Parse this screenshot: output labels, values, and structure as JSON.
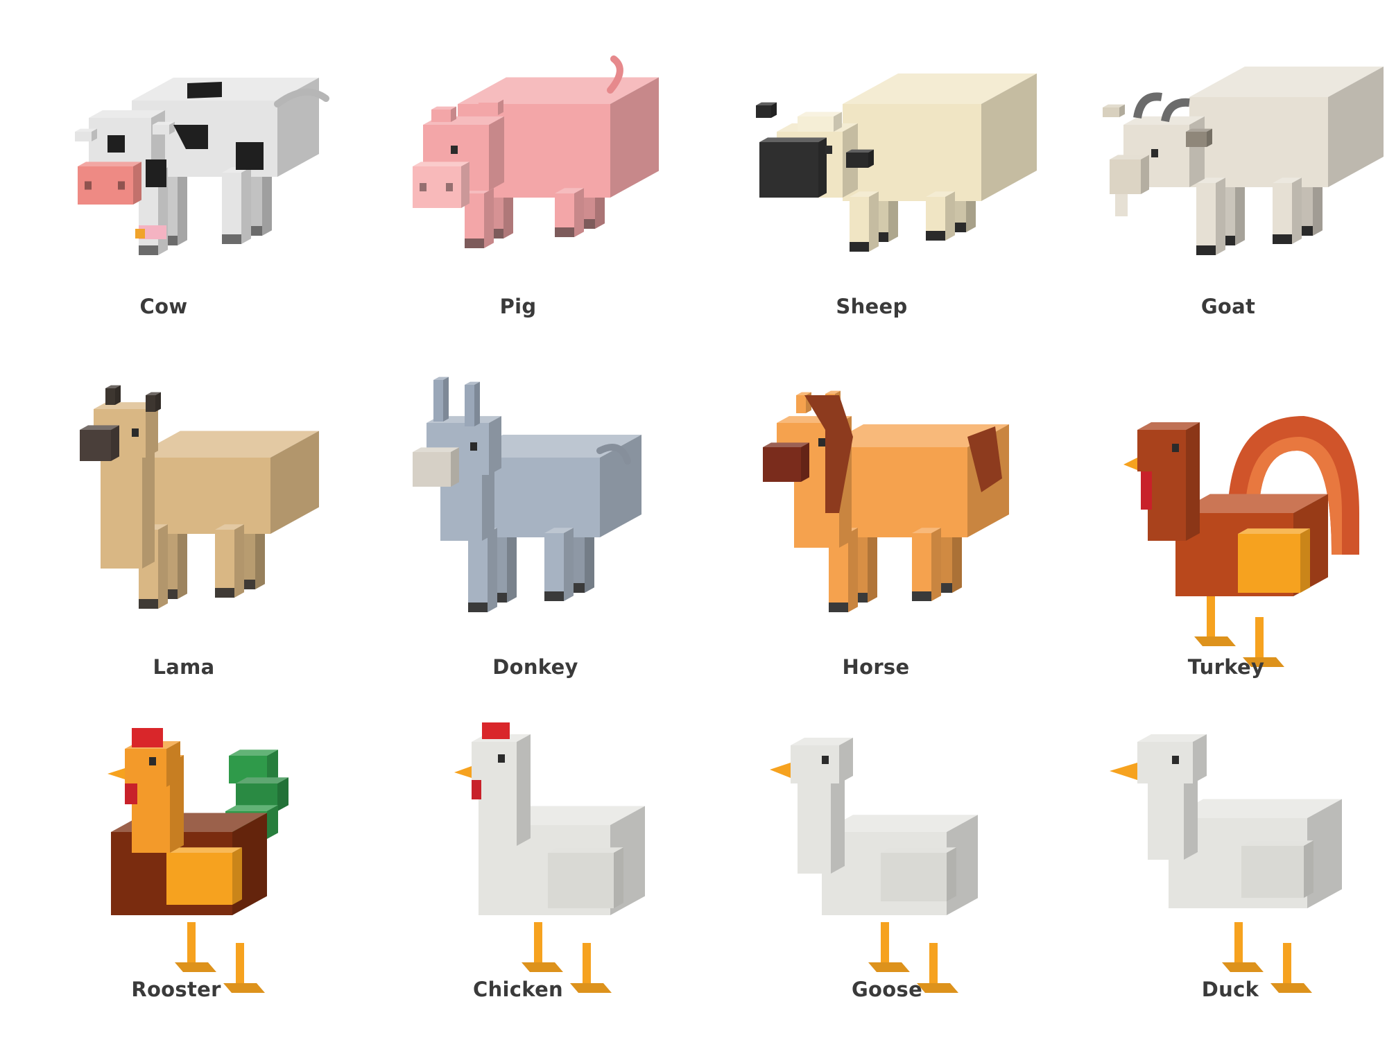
{
  "animals": [
    {
      "label": "Cow",
      "icon": "cow-icon"
    },
    {
      "label": "Pig",
      "icon": "pig-icon"
    },
    {
      "label": "Sheep",
      "icon": "sheep-icon"
    },
    {
      "label": "Goat",
      "icon": "goat-icon"
    },
    {
      "label": "Lama",
      "icon": "lama-icon"
    },
    {
      "label": "Donkey",
      "icon": "donkey-icon"
    },
    {
      "label": "Horse",
      "icon": "horse-icon"
    },
    {
      "label": "Turkey",
      "icon": "turkey-icon"
    },
    {
      "label": "Rooster",
      "icon": "rooster-icon"
    },
    {
      "label": "Chicken",
      "icon": "chicken-icon"
    },
    {
      "label": "Goose",
      "icon": "goose-icon"
    },
    {
      "label": "Duck",
      "icon": "duck-icon"
    }
  ]
}
